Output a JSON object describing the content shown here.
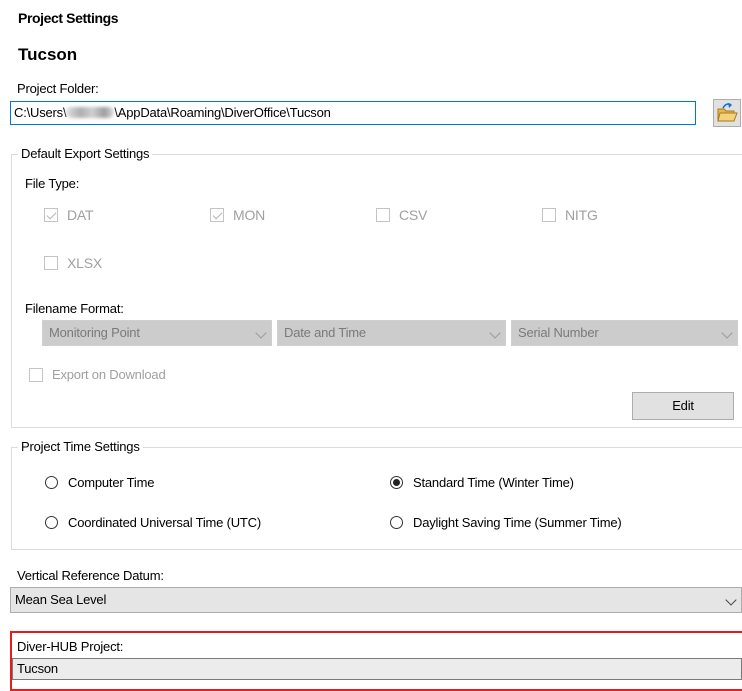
{
  "header": {
    "title": "Project Settings",
    "project_name": "Tucson"
  },
  "project_folder": {
    "label": "Project Folder:",
    "path_prefix": "C:\\Users\\",
    "path_suffix": "\\AppData\\Roaming\\DiverOffice\\Tucson",
    "browse_icon": "folder-open-icon"
  },
  "export_settings": {
    "legend": "Default Export Settings",
    "file_type_label": "File Type:",
    "file_types": [
      {
        "label": "DAT",
        "checked": true
      },
      {
        "label": "MON",
        "checked": true
      },
      {
        "label": "CSV",
        "checked": false
      },
      {
        "label": "NITG",
        "checked": false
      },
      {
        "label": "XLSX",
        "checked": false
      }
    ],
    "filename_format_label": "Filename Format:",
    "filename_parts": [
      "Monitoring Point",
      "Date and Time",
      "Serial Number"
    ],
    "export_on_download_label": "Export on Download",
    "export_on_download_checked": false,
    "edit_label": "Edit"
  },
  "time_settings": {
    "legend": "Project Time Settings",
    "options": [
      {
        "label": "Computer Time",
        "selected": false
      },
      {
        "label": "Standard Time (Winter Time)",
        "selected": true
      },
      {
        "label": "Coordinated Universal Time (UTC)",
        "selected": false
      },
      {
        "label": "Daylight Saving Time (Summer Time)",
        "selected": false
      }
    ]
  },
  "vertical_datum": {
    "label": "Vertical Reference Datum:",
    "value": "Mean Sea Level"
  },
  "diver_hub": {
    "label": "Diver-HUB Project:",
    "value": "Tucson"
  },
  "colors": {
    "focus_border": "#0078d7",
    "highlight_border": "#e81c1c"
  }
}
